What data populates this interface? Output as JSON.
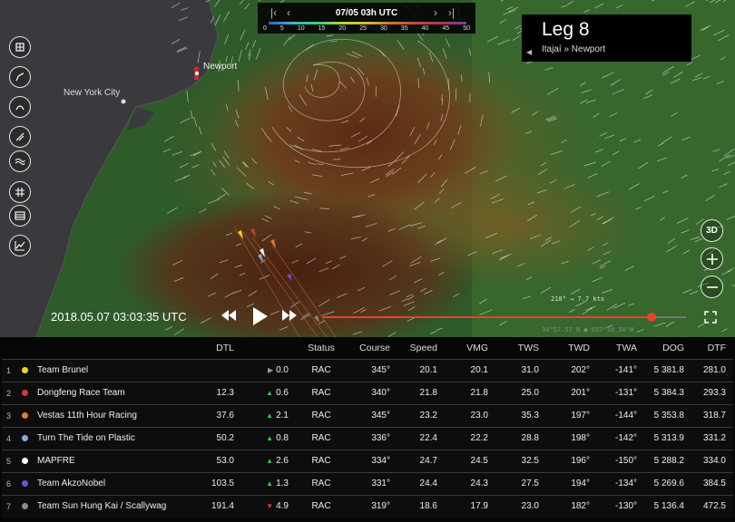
{
  "wind_legend": {
    "time": "07/05 03h UTC",
    "ticks": [
      "0",
      "5",
      "10",
      "15",
      "20",
      "25",
      "30",
      "35",
      "40",
      "45",
      "50"
    ]
  },
  "leg": {
    "title": "Leg 8",
    "route": "Itajaí » Newport"
  },
  "map_labels": {
    "newport": "Newport",
    "new_york": "New York City"
  },
  "right_controls": {
    "three_d": "3D"
  },
  "wind_readout": "218° → 7.7 kts",
  "coord_readout": "34°57.57'N ● 057°18.58'W",
  "playback": {
    "timestamp": "2018.05.07 03:03:35 UTC",
    "progress": 0.905
  },
  "table": {
    "headers": {
      "dtl": "DTL",
      "status": "Status",
      "course": "Course",
      "speed": "Speed",
      "vmg": "VMG",
      "tws": "TWS",
      "twd": "TWD",
      "twa": "TWA",
      "dog": "DOG",
      "dtf": "DTF"
    },
    "rows": [
      {
        "rank": "1",
        "team": "Team Brunel",
        "color": "#f2d51e",
        "dtl": "",
        "trend": "flat",
        "change": "0.0",
        "status": "RAC",
        "course": "345°",
        "speed": "20.1",
        "vmg": "20.1",
        "tws": "31.0",
        "twd": "202°",
        "twa": "-141°",
        "dog": "5 381.8",
        "dtf": "281.0"
      },
      {
        "rank": "2",
        "team": "Dongfeng Race Team",
        "color": "#d6392e",
        "dtl": "12.3",
        "trend": "up",
        "change": "0.6",
        "status": "RAC",
        "course": "340°",
        "speed": "21.8",
        "vmg": "21.8",
        "tws": "25.0",
        "twd": "201°",
        "twa": "-131°",
        "dog": "5 384.3",
        "dtf": "293.3"
      },
      {
        "rank": "3",
        "team": "Vestas 11th Hour Racing",
        "color": "#e07d2a",
        "dtl": "37.6",
        "trend": "up",
        "change": "2.1",
        "status": "RAC",
        "course": "345°",
        "speed": "23.2",
        "vmg": "23.0",
        "tws": "35.3",
        "twd": "197°",
        "twa": "-144°",
        "dog": "5 353.8",
        "dtf": "318.7"
      },
      {
        "rank": "4",
        "team": "Turn The Tide on Plastic",
        "color": "#8aa7e0",
        "dtl": "50.2",
        "trend": "up",
        "change": "0.8",
        "status": "RAC",
        "course": "336°",
        "speed": "22.4",
        "vmg": "22.2",
        "tws": "28.8",
        "twd": "198°",
        "twa": "-142°",
        "dog": "5 313.9",
        "dtf": "331.2"
      },
      {
        "rank": "5",
        "team": "MAPFRE",
        "color": "#ffffff",
        "dtl": "53.0",
        "trend": "up",
        "change": "2.6",
        "status": "RAC",
        "course": "334°",
        "speed": "24.7",
        "vmg": "24.5",
        "tws": "32.5",
        "twd": "196°",
        "twa": "-150°",
        "dog": "5 288.2",
        "dtf": "334.0"
      },
      {
        "rank": "6",
        "team": "Team AkzoNobel",
        "color": "#7452c8",
        "dtl": "103.5",
        "trend": "up",
        "change": "1.3",
        "status": "RAC",
        "course": "331°",
        "speed": "24.4",
        "vmg": "24.3",
        "tws": "27.5",
        "twd": "194°",
        "twa": "-134°",
        "dog": "5 269.6",
        "dtf": "384.5"
      },
      {
        "rank": "7",
        "team": "Team Sun Hung Kai / Scallywag",
        "color": "#8a8a8a",
        "dtl": "191.4",
        "trend": "down",
        "change": "4.9",
        "status": "RAC",
        "course": "319°",
        "speed": "18.6",
        "vmg": "17.9",
        "tws": "23.0",
        "twd": "182°",
        "twa": "-130°",
        "dog": "5 136.4",
        "dtf": "472.5"
      }
    ]
  }
}
